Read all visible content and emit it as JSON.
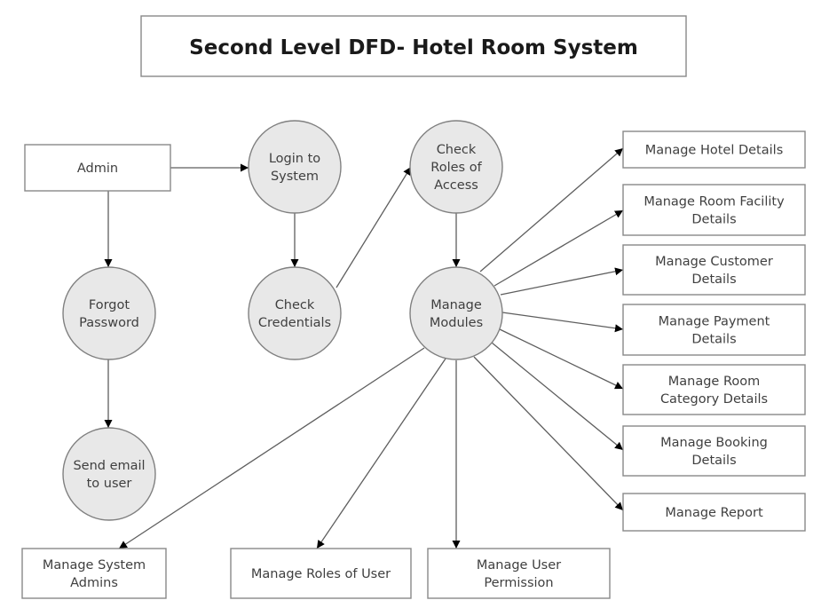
{
  "title": "Second Level DFD- Hotel Room System",
  "colors": {
    "process_fill": "#e8e8e8",
    "process_stroke": "#808080",
    "entity_fill": "#ffffff",
    "entity_stroke": "#888888",
    "flow_line": "#5e5e5e",
    "arrowhead": "#000000",
    "text": "#3f3f3f"
  },
  "nodes": [
    {
      "id": "admin",
      "type": "external-entity",
      "lines": [
        "Admin"
      ]
    },
    {
      "id": "login",
      "type": "process",
      "lines": [
        "Login to",
        "System"
      ]
    },
    {
      "id": "check-credentials",
      "type": "process",
      "lines": [
        "Check",
        "Credentials"
      ]
    },
    {
      "id": "forgot-password",
      "type": "process",
      "lines": [
        "Forgot",
        "Password"
      ]
    },
    {
      "id": "send-email",
      "type": "process",
      "lines": [
        "Send email",
        "to user"
      ]
    },
    {
      "id": "check-roles",
      "type": "process",
      "lines": [
        "Check",
        "Roles of",
        "Access"
      ]
    },
    {
      "id": "manage-modules",
      "type": "process",
      "lines": [
        "Manage",
        "Modules"
      ]
    },
    {
      "id": "manage-hotel-details",
      "type": "module",
      "lines": [
        "Manage Hotel Details"
      ]
    },
    {
      "id": "manage-room-facility-details",
      "type": "module",
      "lines": [
        "Manage Room Facility",
        "Details"
      ]
    },
    {
      "id": "manage-customer-details",
      "type": "module",
      "lines": [
        "Manage Customer",
        "Details"
      ]
    },
    {
      "id": "manage-payment-details",
      "type": "module",
      "lines": [
        "Manage Payment",
        "Details"
      ]
    },
    {
      "id": "manage-room-category-details",
      "type": "module",
      "lines": [
        "Manage Room",
        "Category Details"
      ]
    },
    {
      "id": "manage-booking-details",
      "type": "module",
      "lines": [
        "Manage Booking",
        "Details"
      ]
    },
    {
      "id": "manage-report",
      "type": "module",
      "lines": [
        "Manage Report"
      ]
    },
    {
      "id": "manage-system-admins",
      "type": "module",
      "lines": [
        "Manage System",
        "Admins"
      ]
    },
    {
      "id": "manage-roles-of-user",
      "type": "module",
      "lines": [
        "Manage Roles of User"
      ]
    },
    {
      "id": "manage-user-permission",
      "type": "module",
      "lines": [
        "Manage User",
        "Permission"
      ]
    }
  ],
  "flows": [
    {
      "from": "admin",
      "to": "login"
    },
    {
      "from": "admin",
      "to": "forgot-password"
    },
    {
      "from": "forgot-password",
      "to": "send-email"
    },
    {
      "from": "login",
      "to": "check-credentials"
    },
    {
      "from": "check-credentials",
      "to": "check-roles"
    },
    {
      "from": "check-roles",
      "to": "manage-modules"
    },
    {
      "from": "manage-modules",
      "to": "manage-hotel-details"
    },
    {
      "from": "manage-modules",
      "to": "manage-room-facility-details"
    },
    {
      "from": "manage-modules",
      "to": "manage-customer-details"
    },
    {
      "from": "manage-modules",
      "to": "manage-payment-details"
    },
    {
      "from": "manage-modules",
      "to": "manage-room-category-details"
    },
    {
      "from": "manage-modules",
      "to": "manage-booking-details"
    },
    {
      "from": "manage-modules",
      "to": "manage-report"
    },
    {
      "from": "manage-modules",
      "to": "manage-system-admins"
    },
    {
      "from": "manage-modules",
      "to": "manage-roles-of-user"
    },
    {
      "from": "manage-modules",
      "to": "manage-user-permission"
    }
  ]
}
